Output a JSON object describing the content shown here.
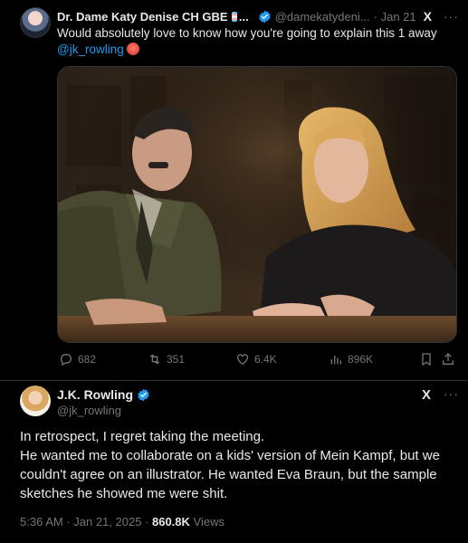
{
  "tweet1": {
    "display_name": "Dr. Dame Katy Denise CH GBE",
    "name_ellipsis": "...",
    "handle": "@damekatydeni...",
    "date": "· Jan 21",
    "x_logo": "X",
    "more": "···",
    "text_line1": "Would absolutely love to know how you're going to explain this 1 away",
    "mention": "@jk_rowling",
    "stats": {
      "replies": "682",
      "reposts": "351",
      "likes": "6.4K",
      "views": "896K"
    }
  },
  "tweet2": {
    "display_name": "J.K. Rowling",
    "handle": "@jk_rowling",
    "x_logo": "X",
    "more": "···",
    "paragraph1": "In retrospect, I regret taking the meeting.",
    "paragraph2": "He wanted me to collaborate on a kids' version of Mein Kampf, but we couldn't agree on an illustrator. He wanted Eva Braun, but the sample sketches he showed me were shit.",
    "timestamp": "5:36 AM · Jan 21, 2025 · ",
    "views_count": "860.8K",
    "views_label": " Views"
  },
  "colors": {
    "accent": "#1d9bf0",
    "text": "#e7e9ea",
    "muted": "#71767b",
    "background": "#000000"
  }
}
